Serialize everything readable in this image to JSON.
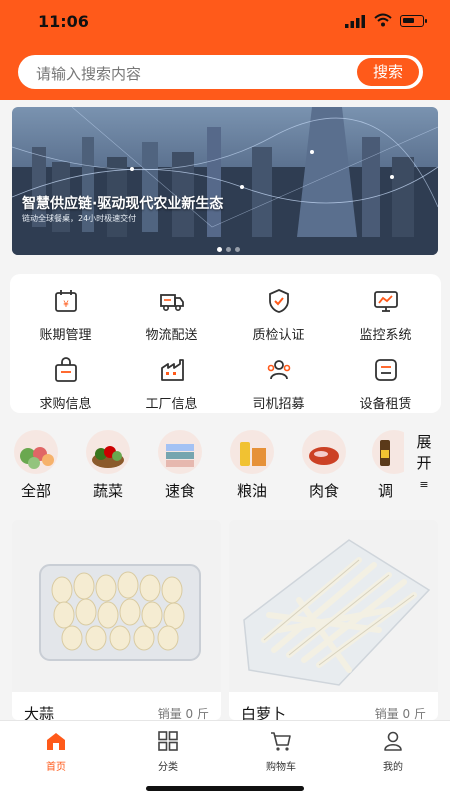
{
  "status_bar": {
    "time": "11:06"
  },
  "search": {
    "placeholder": "请输入搜索内容",
    "button": "搜索"
  },
  "banner": {
    "title": "智慧供应链·驱动现代农业新生态",
    "subtitle": "链动全球餐桌，24小时极速交付"
  },
  "services": [
    {
      "label": "账期管理",
      "icon": "calendar-yen-icon"
    },
    {
      "label": "物流配送",
      "icon": "truck-icon"
    },
    {
      "label": "质检认证",
      "icon": "shield-check-icon"
    },
    {
      "label": "监控系统",
      "icon": "monitor-chart-icon"
    },
    {
      "label": "求购信息",
      "icon": "shopping-bag-icon"
    },
    {
      "label": "工厂信息",
      "icon": "factory-icon"
    },
    {
      "label": "司机招募",
      "icon": "people-icon"
    },
    {
      "label": "设备租赁",
      "icon": "device-icon"
    }
  ],
  "categories": [
    {
      "label": "全部"
    },
    {
      "label": "蔬菜"
    },
    {
      "label": "速食"
    },
    {
      "label": "粮油"
    },
    {
      "label": "肉食"
    },
    {
      "label": "调"
    }
  ],
  "expand": {
    "line1": "展",
    "line2": "开",
    "icon": "≡"
  },
  "products": [
    {
      "name": "大蒜",
      "sales": "销量 0 斤"
    },
    {
      "name": "白萝卜",
      "sales": "销量 0 斤"
    }
  ],
  "tabs": [
    {
      "label": "首页",
      "icon": "home-icon",
      "active": true
    },
    {
      "label": "分类",
      "icon": "grid-icon",
      "active": false
    },
    {
      "label": "购物车",
      "icon": "cart-icon",
      "active": false
    },
    {
      "label": "我的",
      "icon": "user-icon",
      "active": false
    }
  ],
  "colors": {
    "accent": "#ff5a1a"
  }
}
